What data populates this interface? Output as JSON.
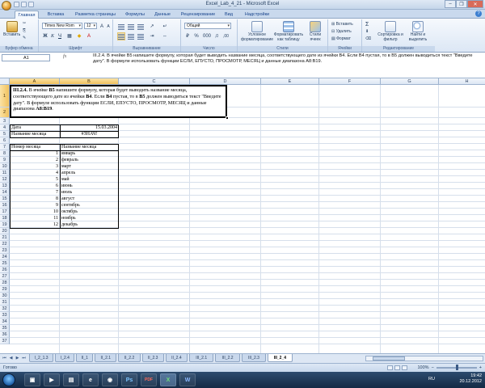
{
  "window": {
    "title": "Excel_Lab_4_21 - Microsoft Excel",
    "controls": [
      "–",
      "❐",
      "✕"
    ]
  },
  "tabs": [
    "Главная",
    "Вставка",
    "Разметка страницы",
    "Формулы",
    "Данные",
    "Рецензирование",
    "Вид",
    "Надстройки"
  ],
  "ribbon": {
    "paste_label": "Вставить",
    "font_name": "Times New Rom",
    "font_size": "12",
    "number_format": "Общий",
    "bold": "Ж",
    "italic": "К",
    "underline": "Ч",
    "cond_format": "Условное форматирование",
    "format_table": "Форматировать как таблицу",
    "cell_styles": "Стили ячеек",
    "insert": "Вставить",
    "delete": "Удалить",
    "format": "Формат",
    "sort_filter": "Сортировка и фильтр",
    "find_select": "Найти и выделить",
    "sum_symbol": "Σ",
    "groups": [
      "Буфер обмена",
      "Шрифт",
      "Выравнивание",
      "Число",
      "Стили",
      "Ячейки",
      "Редактирование"
    ]
  },
  "formula_bar": {
    "name_box": "A1",
    "fx": "fx",
    "content": "III.2.4. В ячейке B5 напишите формулу, которая будет выводить название месяца, соответствующего дате из ячейки B4. Если B4 пустая, то в B5 должен выводиться текст \"Введите дату\". В формуле использовать функции ЕСЛИ, ЕПУСТО, ПРОСМОТР, МЕСЯЦ и данные диапазона A8:B19."
  },
  "columns": [
    "A",
    "B",
    "C",
    "D",
    "E",
    "F",
    "G",
    "H"
  ],
  "rows": [
    "1",
    "2",
    "3",
    "4",
    "5",
    "6",
    "7",
    "8",
    "9",
    "10",
    "11",
    "12",
    "13",
    "14",
    "15",
    "16",
    "17",
    "18",
    "19",
    "20",
    "21",
    "22",
    "23",
    "24",
    "25",
    "26",
    "27",
    "28",
    "29",
    "30",
    "31",
    "32",
    "33",
    "34",
    "35",
    "36",
    "37"
  ],
  "task": {
    "p1": "III.2.4.",
    "p2": " В ячейке ",
    "p3": "B5",
    "p4": " напишите формулу, которая будет выводить название месяца, соответствующего дате из ячейки ",
    "p5": "B4",
    "p6": ". Если ",
    "p7": "B4",
    "p8": " пустая, то в ",
    "p9": "B5",
    "p10": " должен выводиться текст \"Введите дату\". В формуле использовать функции ЕСЛИ, ЕПУСТО, ПРОСМОТР, МЕСЯЦ и данные диапазона ",
    "p11": "A8:B19",
    "p12": "."
  },
  "cells": {
    "a4": "Дата",
    "b4": "15.03.2004",
    "a5": "Название месяца",
    "b5": "#ЗНАЧ!",
    "a7": "Номер месяца",
    "b7": "Название месяца"
  },
  "months": [
    {
      "num": "1",
      "name": "январь"
    },
    {
      "num": "2",
      "name": "февраль"
    },
    {
      "num": "3",
      "name": "март"
    },
    {
      "num": "4",
      "name": "апрель"
    },
    {
      "num": "5",
      "name": "май"
    },
    {
      "num": "6",
      "name": "июнь"
    },
    {
      "num": "7",
      "name": "июль"
    },
    {
      "num": "8",
      "name": "август"
    },
    {
      "num": "9",
      "name": "сентябрь"
    },
    {
      "num": "10",
      "name": "октябрь"
    },
    {
      "num": "11",
      "name": "ноябрь"
    },
    {
      "num": "12",
      "name": "декабрь"
    }
  ],
  "sheet_tabs": [
    "I_2_1.3",
    "I_2.4",
    "II_1",
    "II_2.1",
    "II_2.2",
    "II_2.3",
    "II_2.4",
    "III_2.1",
    "III_2.2",
    "III_2.3",
    "III_2_4"
  ],
  "status": {
    "ready": "Готово",
    "zoom": "100%"
  },
  "taskbar": {
    "lang": "RU",
    "time": "19:42",
    "date": "20.12.2012",
    "icons": [
      "Ps",
      "PDF",
      "X",
      "W"
    ]
  }
}
